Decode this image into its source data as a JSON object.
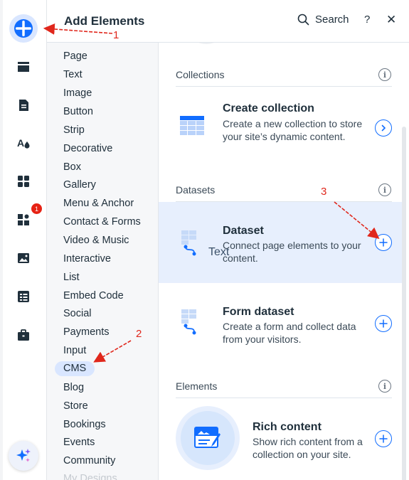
{
  "panel": {
    "title": "Add Elements",
    "search_label": "Search",
    "help_label": "?",
    "close_label": "✕"
  },
  "rail": {
    "badge_count": "1",
    "icons": [
      "add-icon",
      "strip-layout-icon",
      "page-icon",
      "theme-icon",
      "apps-grid-icon",
      "app-market-icon",
      "media-icon",
      "cms-table-icon",
      "portfolio-briefcase-icon",
      "ai-sparkle-icon"
    ]
  },
  "categories": [
    "Page",
    "Text",
    "Image",
    "Button",
    "Strip",
    "Decorative",
    "Box",
    "Gallery",
    "Menu & Anchor",
    "Contact & Forms",
    "Video & Music",
    "Interactive",
    "List",
    "Embed Code",
    "Social",
    "Payments",
    "Input",
    "CMS",
    "Blog",
    "Store",
    "Bookings",
    "Events",
    "Community",
    "My Designs"
  ],
  "selected_category": "CMS",
  "sections": {
    "collections": "Collections",
    "datasets": "Datasets",
    "elements": "Elements"
  },
  "cards": {
    "create_collection": {
      "title": "Create collection",
      "desc": "Create a new collection to store your site’s dynamic content."
    },
    "dataset": {
      "title": "Dataset",
      "desc": "Connect page elements to your content.",
      "drag_text": "Text"
    },
    "form_dataset": {
      "title": "Form dataset",
      "desc": "Create a form and collect data from your visitors."
    },
    "rich_content": {
      "title": "Rich content",
      "desc": "Show rich content from a collection on your site."
    }
  },
  "info_label": "i",
  "annotations": [
    "1",
    "2",
    "3"
  ],
  "colors": {
    "accent": "#116dff",
    "selected_bg": "#d9e6ff",
    "highlight_bg": "#e7effd",
    "annotation": "#e0271c"
  }
}
